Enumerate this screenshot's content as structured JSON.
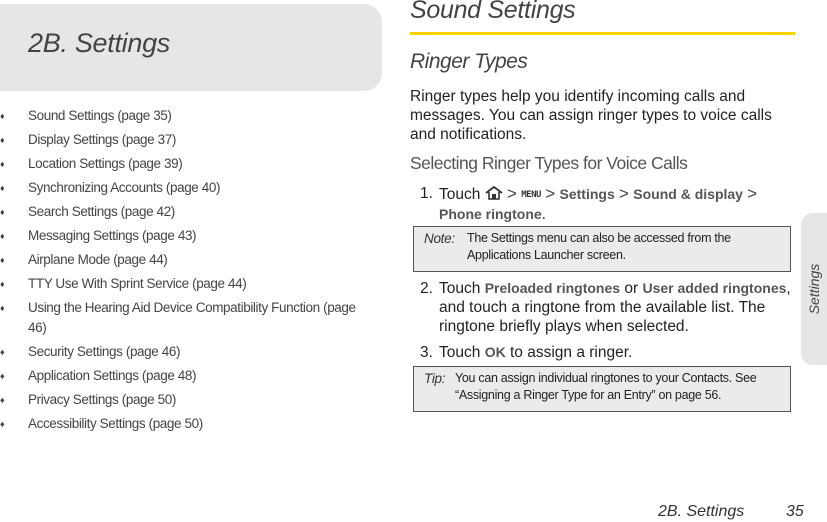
{
  "chapter": {
    "title": "2B. Settings"
  },
  "toc": {
    "bullet_glyph": "♦",
    "items": [
      "Sound Settings (page 35)",
      "Display Settings (page 37)",
      "Location Settings (page 39)",
      "Synchronizing Accounts (page 40)",
      "Search Settings (page 42)",
      "Messaging Settings (page 43)",
      "Airplane Mode (page 44)",
      "TTY Use With Sprint Service (page 44)",
      "Using the Hearing Aid Device Compatibility Function (page 46)",
      "Security Settings (page 46)",
      "Application Settings (page 48)",
      "Privacy Settings (page 50)",
      "Accessibility Settings (page 50)"
    ]
  },
  "main": {
    "section_title": "Sound Settings",
    "subsection_title": "Ringer Types",
    "intro": "Ringer types help you identify incoming calls and messages. You can assign ringer types to voice calls and notifications.",
    "procedure_title": "Selecting Ringer Types for Voice Calls",
    "step1": {
      "num": "1.",
      "touch": "Touch",
      "sep": ">",
      "home_icon": "home-icon",
      "menu_key": "MENU",
      "path1": "Settings",
      "path2": "Sound & display",
      "path3": "Phone ringtone",
      "end": "."
    },
    "note": {
      "label": "Note:",
      "text": "The Settings menu can also be accessed from the Applications Launcher screen."
    },
    "step2": {
      "num": "2.",
      "touch": "Touch",
      "opt1": "Preloaded ringtones",
      "or": "or",
      "opt2": "User added ringtones",
      "rest": ", and touch a ringtone from the available list. The ringtone briefly plays when selected."
    },
    "step3": {
      "num": "3.",
      "touch": "Touch",
      "ok": "OK",
      "rest": "to assign a ringer."
    },
    "tip": {
      "label": "Tip:",
      "text": "You can assign individual ringtones to your Contacts. See “Assigning a Ringer Type for an Entry” on page 56."
    }
  },
  "side_tab": {
    "label": "Settings"
  },
  "footer": {
    "chapter": "2B. Settings",
    "page": "35"
  },
  "colors": {
    "accent_rule": "#f7d300",
    "box_gray": "#e6e6e6"
  }
}
